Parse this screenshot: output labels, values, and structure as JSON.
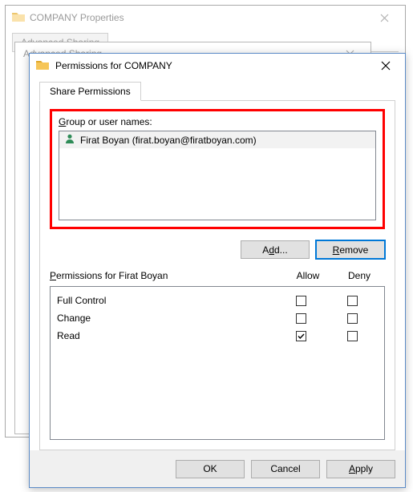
{
  "bg_dialog1": {
    "title": "COMPANY Properties",
    "tab_label": "Advanced Sharing"
  },
  "bg_dialog2": {
    "title": "Advanced Sharing"
  },
  "dialog": {
    "title": "Permissions for COMPANY",
    "tab": "Share Permissions",
    "group_label": "Group or user names:",
    "users": [
      {
        "display": "Firat Boyan (firat.boyan@firatboyan.com)"
      }
    ],
    "buttons": {
      "add": "Add...",
      "remove": "Remove"
    },
    "perm_header_label": "Permissions for Firat Boyan",
    "col_allow": "Allow",
    "col_deny": "Deny",
    "permissions": [
      {
        "name": "Full Control",
        "allow": false,
        "deny": false
      },
      {
        "name": "Change",
        "allow": false,
        "deny": false
      },
      {
        "name": "Read",
        "allow": true,
        "deny": false
      }
    ],
    "footer": {
      "ok": "OK",
      "cancel": "Cancel",
      "apply": "Apply"
    }
  }
}
